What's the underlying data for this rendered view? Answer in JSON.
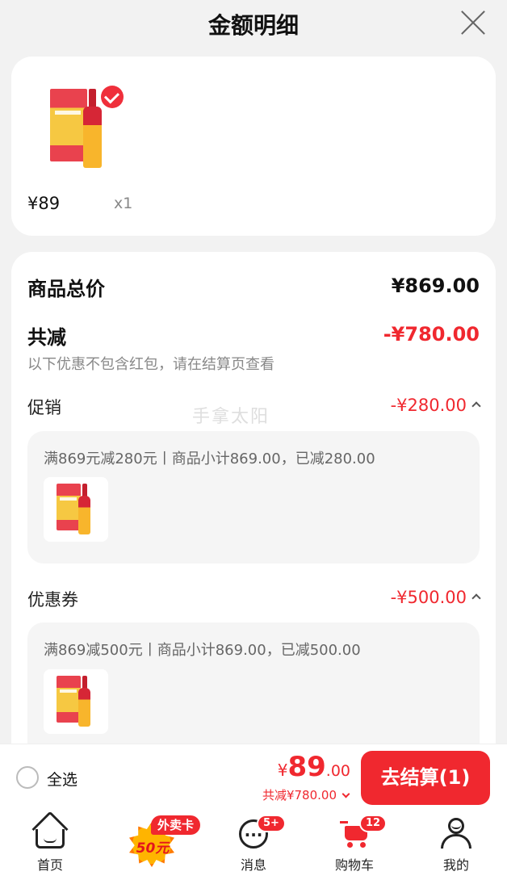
{
  "header": {
    "title": "金额明细"
  },
  "product": {
    "price": "¥89",
    "qty": "x1"
  },
  "summary": {
    "total_label": "商品总价",
    "total_value": "¥869.00",
    "discount_label": "共减",
    "discount_value": "-¥780.00",
    "note": "以下优惠不包含红包，请在结算页查看"
  },
  "promotion": {
    "label": "促销",
    "value": "-¥280.00",
    "detail": "满869元减280元丨商品小计869.00，已减280.00"
  },
  "coupon": {
    "label": "优惠券",
    "value": "-¥500.00",
    "detail": "满869减500元丨商品小计869.00，已减500.00"
  },
  "watermark": "手拿太阳",
  "checkout": {
    "select_all": "全选",
    "currency": "¥",
    "total_int": "89",
    "total_dec": ".00",
    "reduced": "共减¥780.00",
    "pay_button": "去结算(1)"
  },
  "tabbar": {
    "home": "首页",
    "promo_tag": "外卖卡",
    "promo_amount": "50元",
    "messages": "消息",
    "messages_badge": "5+",
    "cart": "购物车",
    "cart_badge": "12",
    "me": "我的"
  },
  "colors": {
    "accent": "#f0282f",
    "background": "#f2f2f2"
  }
}
